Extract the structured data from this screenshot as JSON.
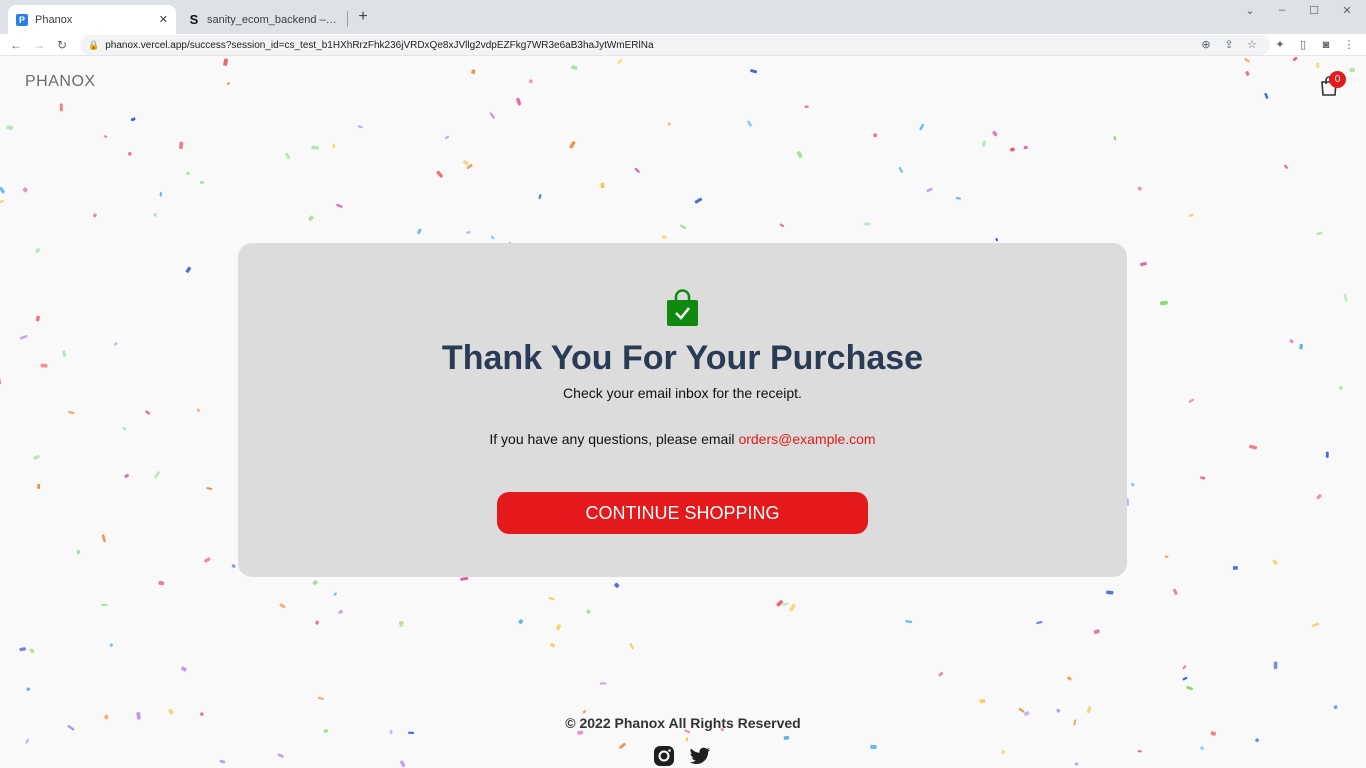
{
  "browser": {
    "tabs": [
      {
        "title": "Phanox",
        "favicon": "P",
        "active": true
      },
      {
        "title": "sanity_ecom_backend – Sanity",
        "favicon": "S",
        "active": false
      }
    ],
    "url": "phanox.vercel.app/success?session_id=cs_test_b1HXhRrzFhk236jVRDxQe8xJVllg2vdpEZFkg7WR3e6aB3haJytWmERlNa"
  },
  "header": {
    "brand": "PHANOX",
    "cart_count": "0"
  },
  "success": {
    "title": "Thank You For Your Purchase",
    "subtitle": "Check your email inbox for the receipt.",
    "question_prefix": "If you have any questions, please email",
    "email": "orders@example.com",
    "button_label": "CONTINUE SHOPPING"
  },
  "footer": {
    "copyright": "© 2022 Phanox All Rights Reserved",
    "social": [
      "instagram-icon",
      "twitter-icon"
    ]
  },
  "colors": {
    "accent": "#e3191c",
    "title": "#2a3b55",
    "bag": "#0f8a0f",
    "card": "#dcdcdc"
  }
}
